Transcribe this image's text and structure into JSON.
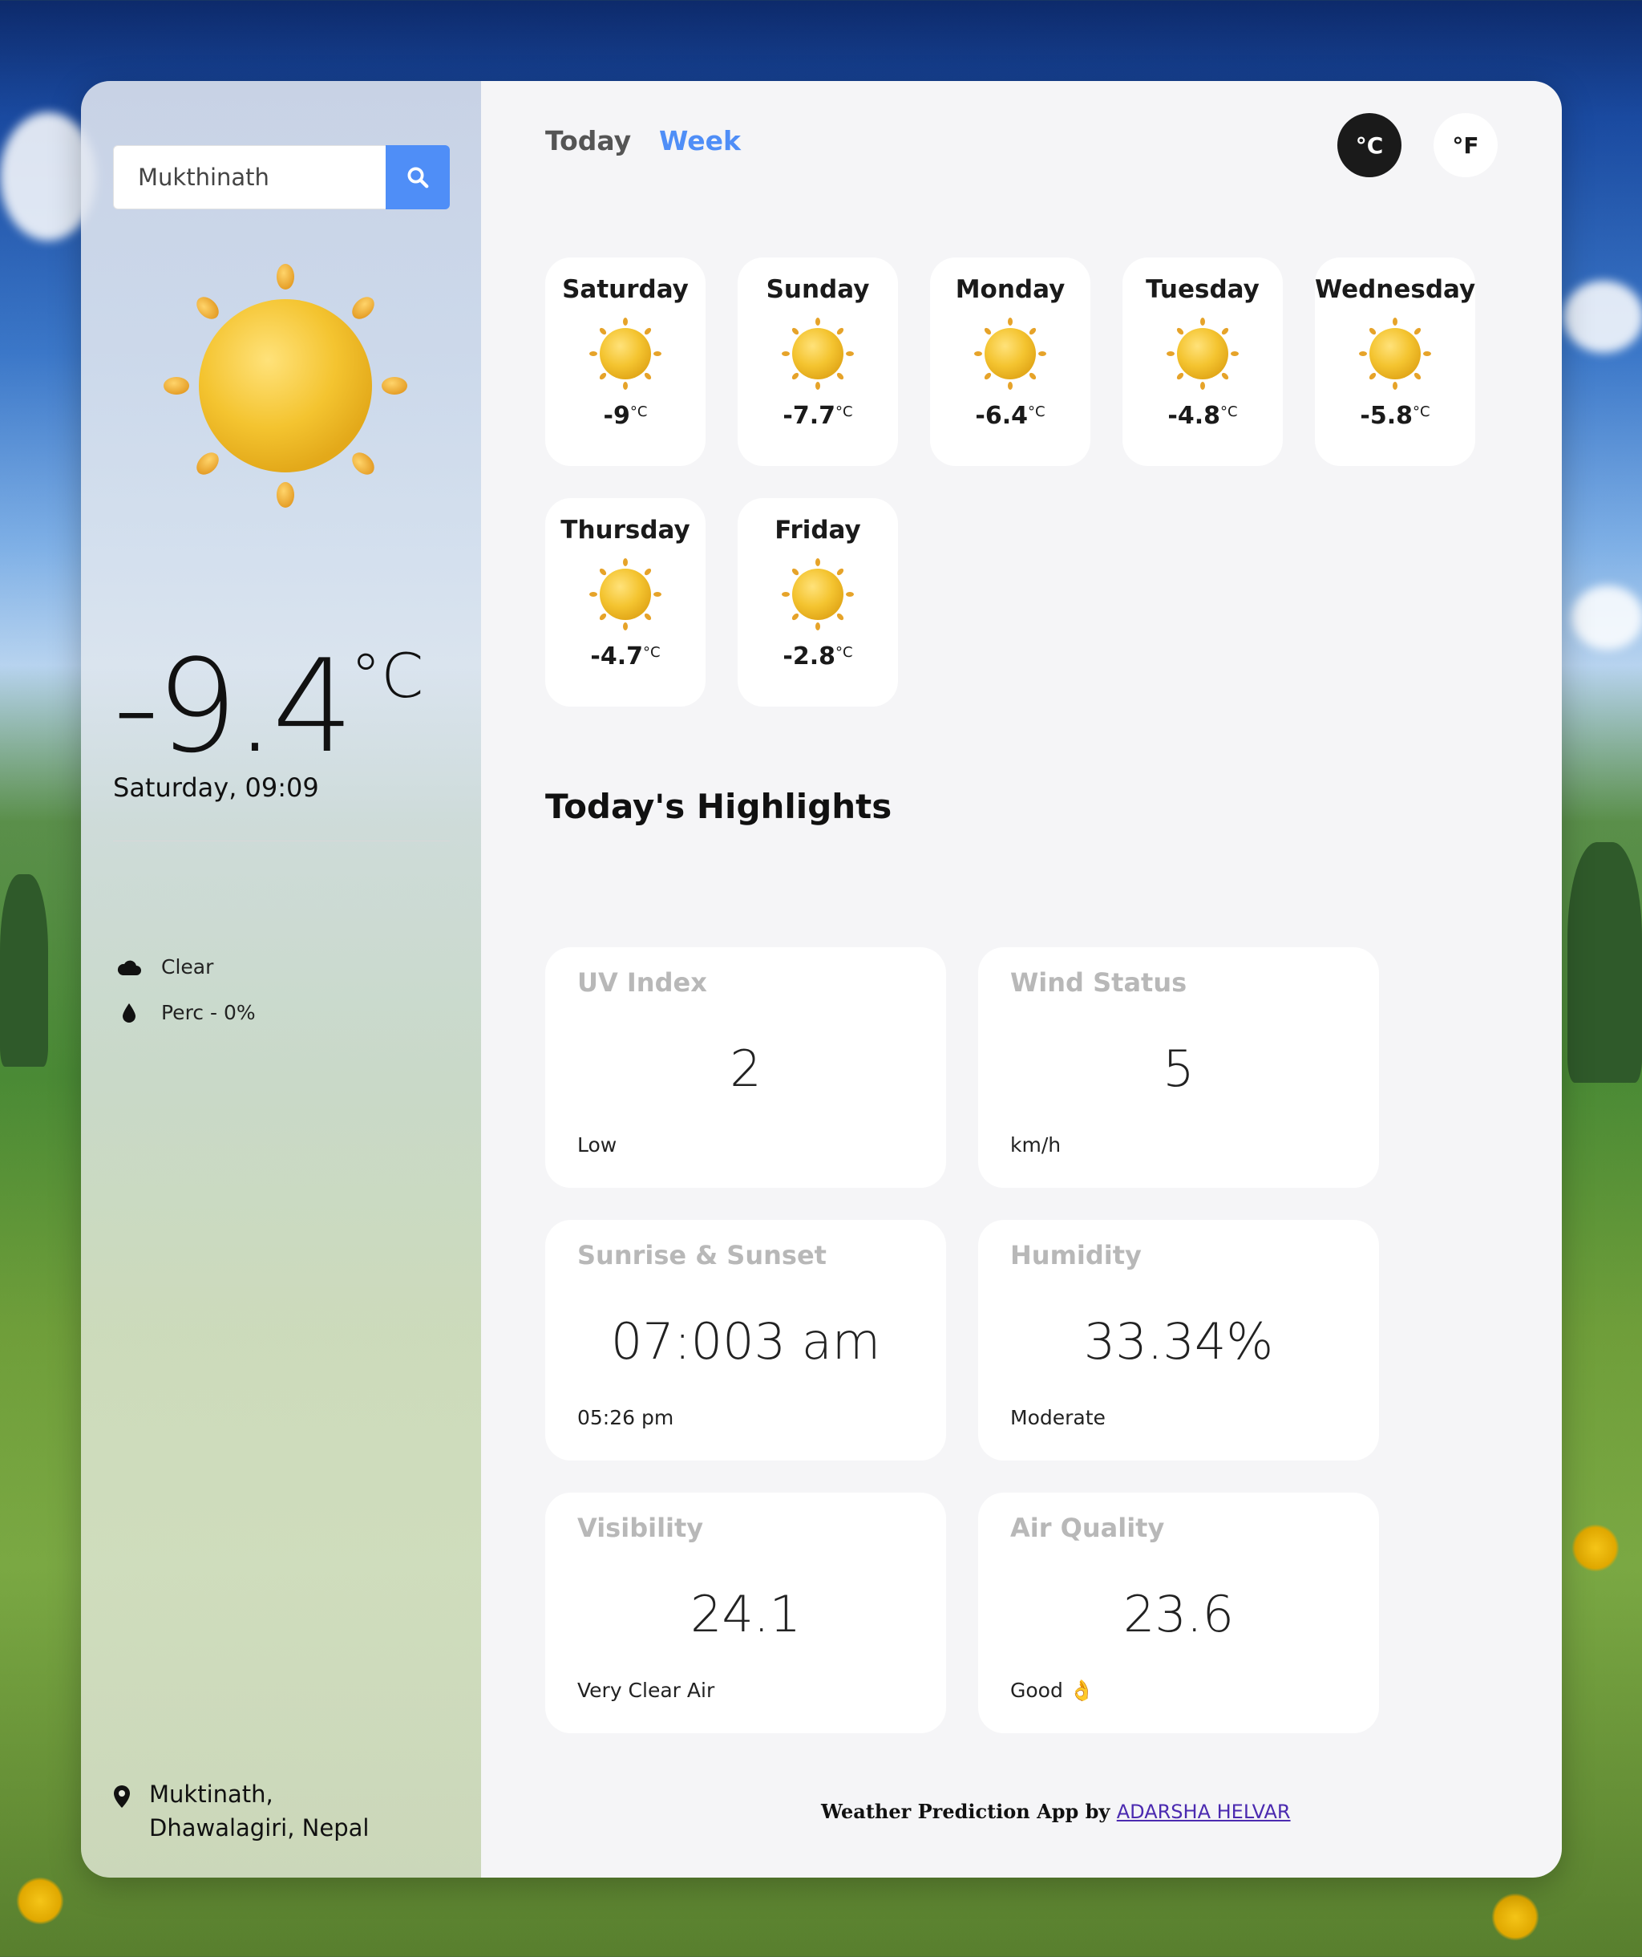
{
  "search": {
    "value": "Mukthinath"
  },
  "current": {
    "temp": "-9.4",
    "unit": "°C",
    "datetime": "Saturday, 09:09",
    "condition": "Clear",
    "precipitation": "Perc - 0%",
    "location": "Muktinath, Dhawalagiri, Nepal"
  },
  "tabs": {
    "today": "Today",
    "week": "Week"
  },
  "units": {
    "celsius": "°C",
    "fahrenheit": "°F"
  },
  "forecast": [
    {
      "day": "Saturday",
      "temp": "-9",
      "unit": "°C"
    },
    {
      "day": "Sunday",
      "temp": "-7.7",
      "unit": "°C"
    },
    {
      "day": "Monday",
      "temp": "-6.4",
      "unit": "°C"
    },
    {
      "day": "Tuesday",
      "temp": "-4.8",
      "unit": "°C"
    },
    {
      "day": "Wednesday",
      "temp": "-5.8",
      "unit": "°C"
    },
    {
      "day": "Thursday",
      "temp": "-4.7",
      "unit": "°C"
    },
    {
      "day": "Friday",
      "temp": "-2.8",
      "unit": "°C"
    }
  ],
  "highlights": {
    "title": "Today's Highlights",
    "uv": {
      "title": "UV Index",
      "value": "2",
      "sub": "Low"
    },
    "wind": {
      "title": "Wind Status",
      "value": "5",
      "sub": "km/h"
    },
    "sun": {
      "title": "Sunrise & Sunset",
      "value": "07:003 am",
      "sub": "05:26 pm"
    },
    "humidity": {
      "title": "Humidity",
      "value": "33.34%",
      "sub": "Moderate"
    },
    "visibility": {
      "title": "Visibility",
      "value": "24.1",
      "sub": "Very Clear Air"
    },
    "air": {
      "title": "Air Quality",
      "value": "23.6",
      "sub": "Good 👌"
    }
  },
  "footer": {
    "text": "Weather Prediction App by",
    "link": "ADARSHA HELVAR"
  },
  "colors": {
    "accent": "#4f8ef7",
    "dark": "#1a1a1a",
    "sun": "#f2c230"
  }
}
